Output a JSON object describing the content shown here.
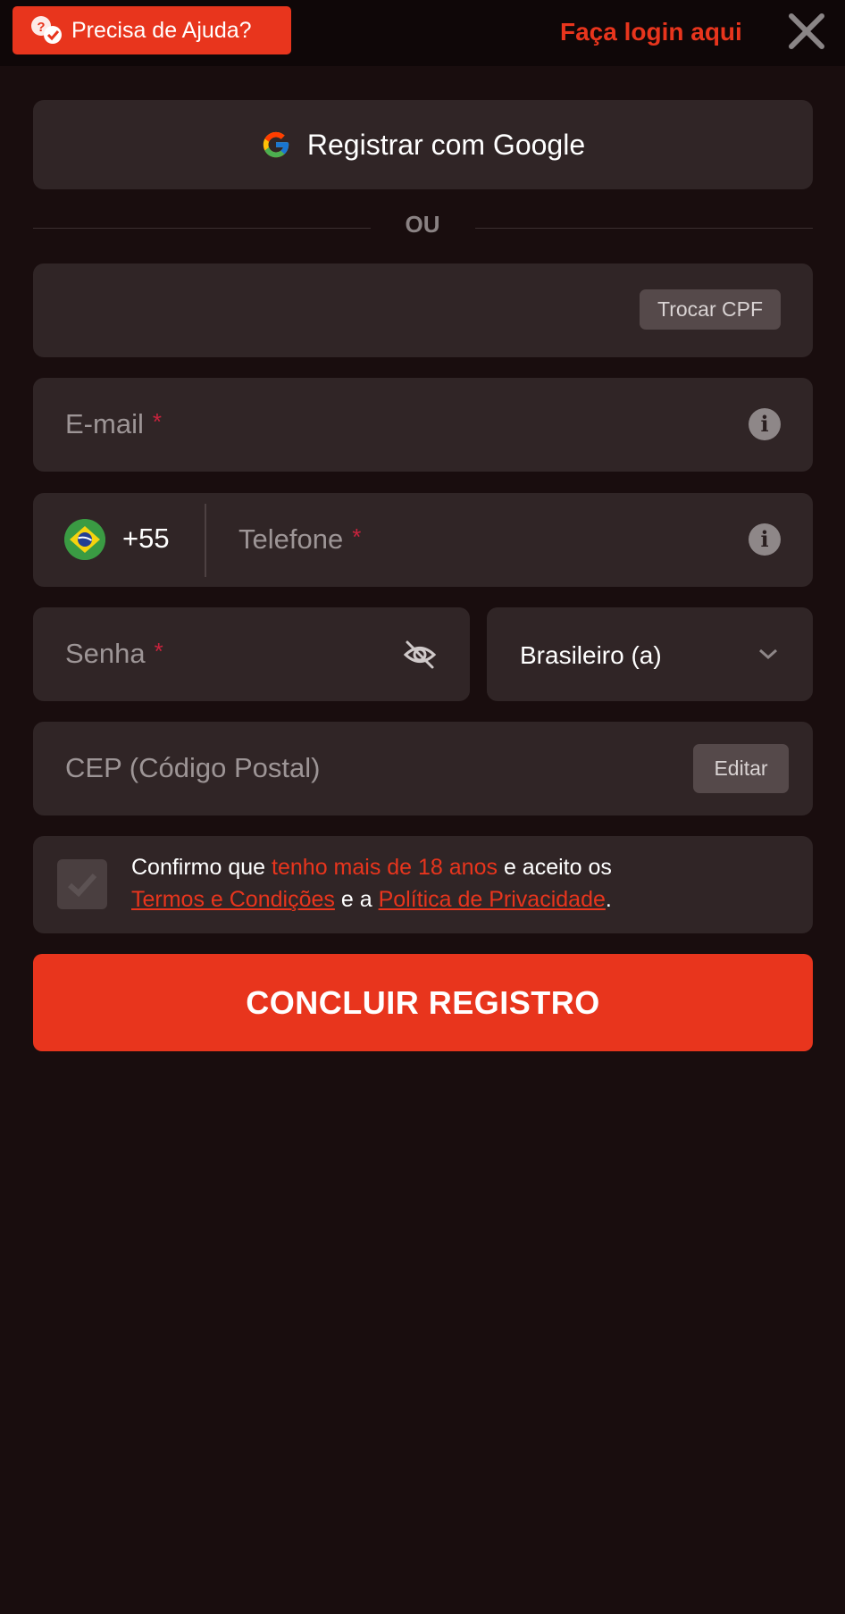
{
  "header": {
    "help_label": "Precisa de Ajuda?",
    "login_label": "Faça login aqui"
  },
  "google": {
    "label": "Registrar com Google"
  },
  "divider": {
    "label": "OU"
  },
  "cpf": {
    "change_label": "Trocar CPF"
  },
  "email": {
    "placeholder": "E-mail",
    "required_mark": "*"
  },
  "phone": {
    "dial_code": "+55",
    "placeholder": "Telefone",
    "required_mark": "*"
  },
  "password": {
    "placeholder": "Senha",
    "required_mark": "*"
  },
  "nationality": {
    "selected": "Brasileiro (a)"
  },
  "cep": {
    "placeholder": "CEP (Código Postal)",
    "edit_label": "Editar"
  },
  "terms": {
    "prefix": "Confirmo que",
    "age_text": "tenho mais de 18 anos",
    "middle": "e aceito os",
    "terms_link": "Termos e Condições",
    "and": "e a",
    "privacy_link": "Política de Privacidade",
    "suffix": "."
  },
  "submit": {
    "label": "CONCLUIR REGISTRO"
  },
  "colors": {
    "accent": "#e8351d",
    "background": "#190d0e",
    "field": "#302526"
  }
}
